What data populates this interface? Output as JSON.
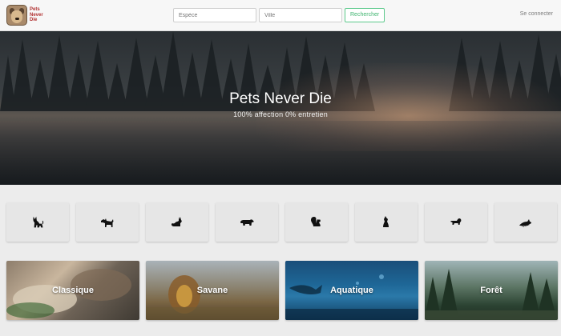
{
  "brand": {
    "logo_text": "Pets Never Die"
  },
  "search": {
    "species_placeholder": "Espèce",
    "city_placeholder": "Ville",
    "button_label": "Rechercher"
  },
  "header": {
    "login_label": "Se connecter"
  },
  "hero": {
    "title": "Pets Never Die",
    "subtitle": "100% affection 0% entretien"
  },
  "animal_icons": [
    {
      "icon": "cat-icon"
    },
    {
      "icon": "dog-icon"
    },
    {
      "icon": "fox-icon"
    },
    {
      "icon": "bear-icon"
    },
    {
      "icon": "squirrel-icon"
    },
    {
      "icon": "wolf-icon"
    },
    {
      "icon": "lion-icon"
    },
    {
      "icon": "fish-icon"
    }
  ],
  "categories": [
    {
      "label": "Classique"
    },
    {
      "label": "Savane"
    },
    {
      "label": "Aquatique"
    },
    {
      "label": "Forêt"
    }
  ],
  "colors": {
    "accent_green": "#3fb46f",
    "brand_red": "#b13030"
  }
}
